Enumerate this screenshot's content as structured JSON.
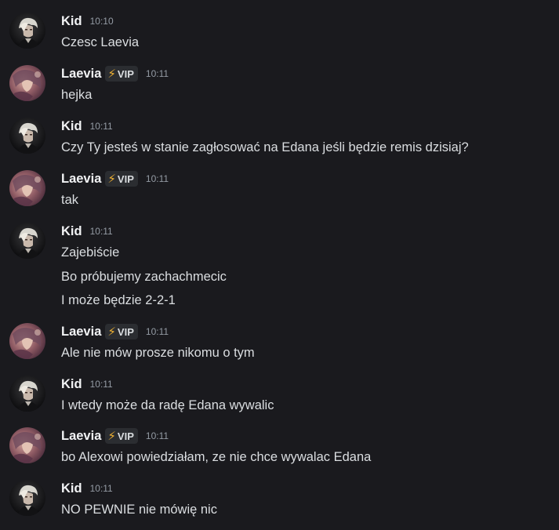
{
  "messages": [
    {
      "author": "Kid",
      "badge": null,
      "time": "10:10",
      "avatar": "kid-avatar",
      "lines": [
        "Czesc Laevia"
      ]
    },
    {
      "author": "Laevia",
      "badge": "VIP",
      "time": "10:11",
      "avatar": "laevia-avatar",
      "lines": [
        "hejka"
      ]
    },
    {
      "author": "Kid",
      "badge": null,
      "time": "10:11",
      "avatar": "kid-avatar",
      "lines": [
        "Czy Ty jesteś w stanie zagłosować na Edana jeśli będzie remis dzisiaj?"
      ]
    },
    {
      "author": "Laevia",
      "badge": "VIP",
      "time": "10:11",
      "avatar": "laevia-avatar",
      "lines": [
        "tak"
      ]
    },
    {
      "author": "Kid",
      "badge": null,
      "time": "10:11",
      "avatar": "kid-avatar",
      "lines": [
        "Zajebiście",
        "Bo próbujemy zachachmecic",
        "I może będzie 2-2-1"
      ]
    },
    {
      "author": "Laevia",
      "badge": "VIP",
      "time": "10:11",
      "avatar": "laevia-avatar",
      "lines": [
        "Ale nie mów prosze nikomu o tym"
      ]
    },
    {
      "author": "Kid",
      "badge": null,
      "time": "10:11",
      "avatar": "kid-avatar",
      "lines": [
        "I wtedy może da radę Edana wywalic"
      ]
    },
    {
      "author": "Laevia",
      "badge": "VIP",
      "time": "10:11",
      "avatar": "laevia-avatar",
      "lines": [
        "bo Alexowi powiedziałam, ze nie chce wywalac Edana"
      ]
    },
    {
      "author": "Kid",
      "badge": null,
      "time": "10:11",
      "avatar": "kid-avatar",
      "lines": [
        "NO PEWNIE nie mówię nic"
      ]
    }
  ],
  "badge_icon": "lightning-bolt-icon",
  "colors": {
    "background": "#1a1a1e",
    "username": "#f2f3f5",
    "message_text": "#dbdee1",
    "timestamp": "#949ba4",
    "badge_bg": "#2b2d31",
    "bolt": "#f0b232"
  }
}
